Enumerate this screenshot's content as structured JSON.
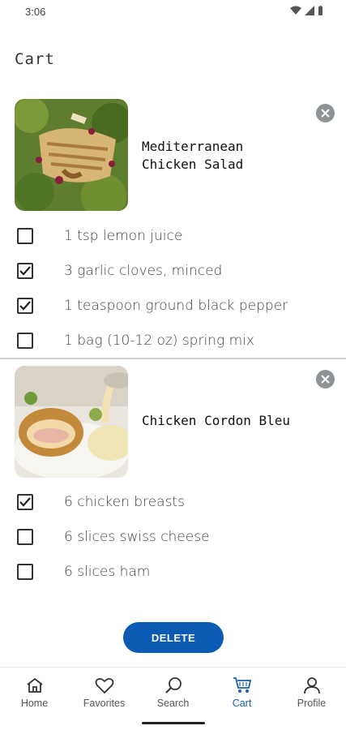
{
  "status_bar": {
    "time": "3:06",
    "icons": [
      "wifi-icon",
      "signal-icon",
      "battery-icon"
    ]
  },
  "page": {
    "title": "Cart"
  },
  "recipes": [
    {
      "name_line1": "Mediterranean",
      "name_line2": "Chicken Salad",
      "ingredients": [
        {
          "label": "1 tsp lemon juice",
          "checked": false
        },
        {
          "label": "3 garlic cloves, minced",
          "checked": true
        },
        {
          "label": "1 teaspoon ground black pepper",
          "checked": true
        },
        {
          "label": "1 bag (10-12 oz) spring mix",
          "checked": false
        }
      ]
    },
    {
      "name_line1": "Chicken Cordon Bleu",
      "name_line2": "",
      "ingredients": [
        {
          "label": "6 chicken breasts",
          "checked": true
        },
        {
          "label": "6 slices swiss cheese",
          "checked": false
        },
        {
          "label": "6 slices ham",
          "checked": false
        }
      ]
    }
  ],
  "actions": {
    "delete_label": "DELETE"
  },
  "nav": {
    "items": [
      {
        "label": "Home",
        "icon": "home-icon",
        "active": false
      },
      {
        "label": "Favorites",
        "icon": "heart-icon",
        "active": false
      },
      {
        "label": "Search",
        "icon": "search-icon",
        "active": false
      },
      {
        "label": "Cart",
        "icon": "cart-icon",
        "active": true
      },
      {
        "label": "Profile",
        "icon": "profile-icon",
        "active": false
      }
    ]
  },
  "colors": {
    "accent": "#0b5bb5",
    "nav_active": "#1a5fb0",
    "remove_button": "#8e9496"
  }
}
